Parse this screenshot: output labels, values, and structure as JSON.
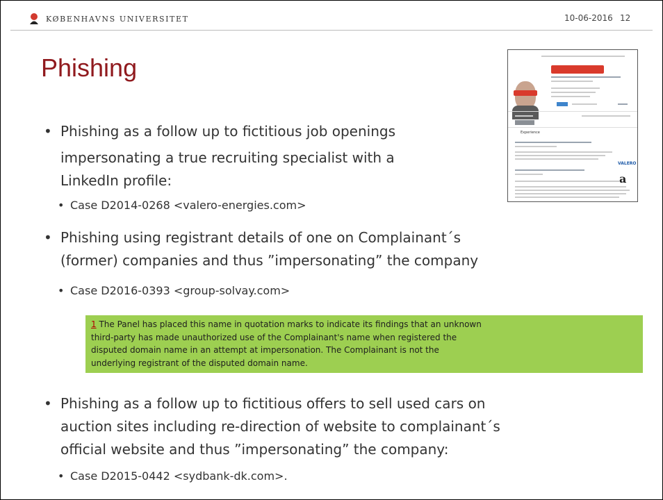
{
  "header": {
    "logo_text": "KØBENHAVNS UNIVERSITET",
    "date": "10-06-2016",
    "page_number": "12"
  },
  "title": "Phishing",
  "bullets": [
    {
      "lines": [
        "Phishing as a follow up to fictitious job openings",
        "impersonating a true recruiting specialist with a",
        "LinkedIn profile:"
      ],
      "sub": "Case D2014-0268 <valero-energies.com>"
    },
    {
      "lines": [
        "Phishing using registrant details of one on Complainant´s",
        "(former) companies and thus ”impersonating” the company"
      ],
      "sub": "Case D2016-0393 <group-solvay.com>"
    },
    {
      "lines": [
        "Phishing as a follow up to fictitious offers to sell used cars on",
        "auction sites including re-direction of website to complainant´s",
        "official website and thus ”impersonating” the company:"
      ],
      "sub": "Case D2015-0442 <sydbank-dk.com>."
    }
  ],
  "footnote": {
    "marker": "1",
    "lines": [
      " The Panel has placed this name in quotation marks to indicate its findings that an unknown",
      "third-party has made unauthorized use of the Complainant's name when registered the",
      "disputed domain name in an attempt at impersonation. The Complainant is not the",
      "underlying registrant of the disputed domain name."
    ]
  },
  "thumbnail": {
    "section_label": "Experience",
    "logo_valero": "VALERO",
    "logo_amazon": "a"
  },
  "colors": {
    "title": "#901a1e",
    "note_background": "#9dcf51",
    "logo_red": "#d23a2f"
  },
  "icons": {
    "bullet": "•"
  }
}
